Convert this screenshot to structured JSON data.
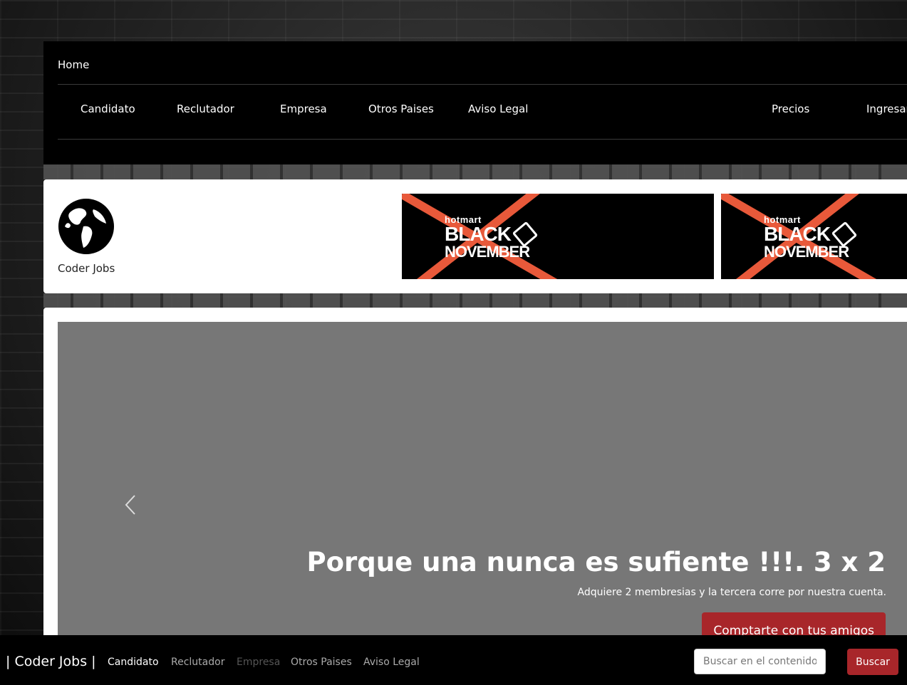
{
  "topnav": {
    "home": "Home",
    "links": [
      "Candidato",
      "Reclutador",
      "Empresa",
      "Otros Paises",
      "Aviso Legal"
    ],
    "right_links": [
      "Precios",
      "Ingresar"
    ]
  },
  "header": {
    "logo_text": "Coder Jobs",
    "banner": {
      "brand_small": "hotmart",
      "brand_line1": "BLACK",
      "brand_line2": "NOVEMBER"
    }
  },
  "carousel": {
    "title": "Porque una nunca es sufiente !!!. 3 x 2",
    "subtitle": "Adquiere 2 membresias y la tercera corre por nuestra cuenta.",
    "cta_label": "Comptarte con tus amigos"
  },
  "bottombar": {
    "brand": "| Coder Jobs |",
    "links": [
      "Candidato",
      "Reclutador",
      "Empresa",
      "Otros Paises",
      "Aviso Legal"
    ],
    "search_placeholder": "Buscar en el contenido",
    "search_button": "Buscar"
  },
  "colors": {
    "accent": "#a8262a",
    "banner_stripe": "#e8593a",
    "carousel_bg": "#777777"
  }
}
